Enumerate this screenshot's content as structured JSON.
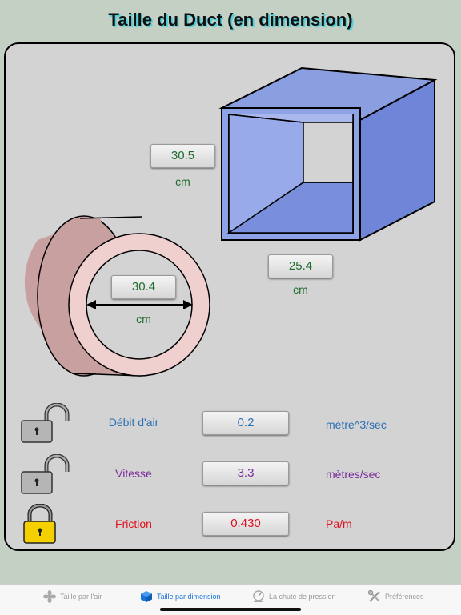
{
  "title": "Taille du Duct (en dimension)",
  "rect_duct": {
    "height_value": "30.5",
    "height_unit": "cm",
    "width_value": "25.4",
    "width_unit": "cm"
  },
  "round_duct": {
    "diameter_value": "30.4",
    "diameter_unit": "cm"
  },
  "rows": [
    {
      "label": "Débit d'air",
      "value": "0.2",
      "unit": "mètre^3/sec",
      "locked": false
    },
    {
      "label": "Vitesse",
      "value": "3.3",
      "unit": "mètres/sec",
      "locked": false
    },
    {
      "label": "Friction",
      "value": "0.430",
      "unit": "Pa/m",
      "locked": true
    }
  ],
  "colors": {
    "airflow": "#2a6fb5",
    "velocity": "#7a2a9a",
    "friction": "#e01020",
    "active_tab": "#1a73d9"
  },
  "tabs": [
    {
      "label": "Taille par l'air",
      "icon": "fan-icon"
    },
    {
      "label": "Taille par dimension",
      "icon": "cube-icon",
      "active": true
    },
    {
      "label": "La chute de pression",
      "icon": "gauge-icon"
    },
    {
      "label": "Préférences",
      "icon": "tools-icon"
    }
  ]
}
